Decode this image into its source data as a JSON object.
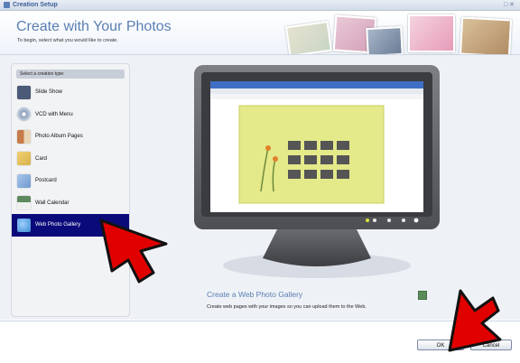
{
  "window": {
    "title": "Creation Setup",
    "controls": "□ ✕"
  },
  "banner": {
    "heading": "Create with Your Photos",
    "subheading": "To begin, select what you would like to create."
  },
  "sidebar": {
    "header": "Select a creation type:",
    "items": [
      {
        "label": "Slide Show",
        "icon": "slide-show-icon",
        "color": "#4a5a78"
      },
      {
        "label": "VCD with Menu",
        "icon": "vcd-disc-icon",
        "color": "#8a9ab8"
      },
      {
        "label": "Photo Album Pages",
        "icon": "album-pages-icon",
        "color": "#c77b4a"
      },
      {
        "label": "Card",
        "icon": "card-icon",
        "color": "#d8b24a"
      },
      {
        "label": "Postcard",
        "icon": "postcard-icon",
        "color": "#6f9ad0"
      },
      {
        "label": "Wall Calendar",
        "icon": "calendar-icon",
        "color": "#5f8a5f"
      },
      {
        "label": "Web Photo Gallery",
        "icon": "web-gallery-icon",
        "color": "#3a8ad0",
        "selected": true
      }
    ]
  },
  "preview": {
    "title": "Create a Web Photo Gallery",
    "description": "Create web pages with your images so you can upload them to the Web."
  },
  "footer": {
    "ok_label": "OK",
    "cancel_label": "Cancel"
  },
  "colors": {
    "selected_bg": "#0a0a7a",
    "accent": "#5b7fb2",
    "annotation_arrow": "#e00000"
  }
}
